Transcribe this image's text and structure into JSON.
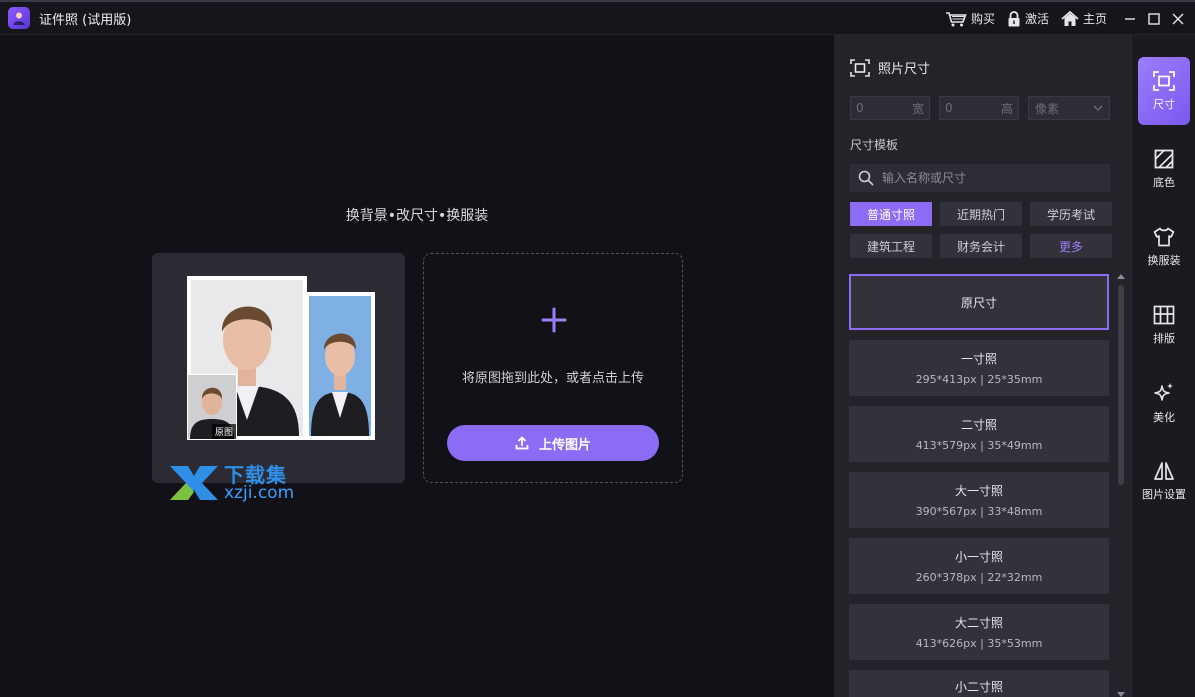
{
  "titlebar": {
    "app_title": "证件照 (试用版)",
    "actions": [
      {
        "label": "购买",
        "icon": "cart-icon"
      },
      {
        "label": "激活",
        "icon": "lock-icon"
      },
      {
        "label": "主页",
        "icon": "home-icon"
      }
    ]
  },
  "main": {
    "tagline": "换背景•改尺寸•换服装",
    "sample_orig_label": "原图",
    "upload_hint": "将原图拖到此处，或者点击上传",
    "upload_button": "上传图片",
    "watermark_cn": "下载集",
    "watermark_en": "xzji.com"
  },
  "panel": {
    "title": "照片尺寸",
    "width_value": "0",
    "width_unit": "宽",
    "height_value": "0",
    "height_unit": "高",
    "unit_select": "像素",
    "template_label": "尺寸模板",
    "search_placeholder": "输入名称或尺寸",
    "categories": [
      "普通寸照",
      "近期热门",
      "学历考试",
      "建筑工程",
      "财务会计",
      "更多"
    ],
    "sizes": [
      {
        "name": "原尺寸",
        "spec": ""
      },
      {
        "name": "一寸照",
        "spec": "295*413px | 25*35mm"
      },
      {
        "name": "二寸照",
        "spec": "413*579px | 35*49mm"
      },
      {
        "name": "大一寸照",
        "spec": "390*567px | 33*48mm"
      },
      {
        "name": "小一寸照",
        "spec": "260*378px | 22*32mm"
      },
      {
        "name": "大二寸照",
        "spec": "413*626px | 35*53mm"
      },
      {
        "name": "小二寸照",
        "spec": ""
      }
    ]
  },
  "rail": {
    "items": [
      {
        "label": "尺寸",
        "icon": "crop-frame-icon"
      },
      {
        "label": "底色",
        "icon": "background-color-icon"
      },
      {
        "label": "换服装",
        "icon": "shirt-icon"
      },
      {
        "label": "排版",
        "icon": "layout-grid-icon"
      },
      {
        "label": "美化",
        "icon": "sparkle-icon"
      },
      {
        "label": "图片设置",
        "icon": "mirror-icon"
      }
    ]
  },
  "colors": {
    "accent": "#8c6cf5",
    "panel_bg": "#24232a",
    "canvas_bg": "#121117"
  }
}
